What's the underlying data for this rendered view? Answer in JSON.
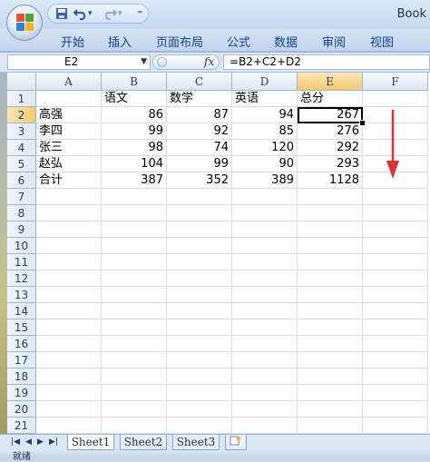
{
  "window": {
    "title": "Book"
  },
  "qat": {
    "undo_arrow": "▾",
    "redo_arrow": "▾",
    "customize": "⁼"
  },
  "ribbon": {
    "tabs": [
      "开始",
      "插入",
      "页面布局",
      "公式",
      "数据",
      "审阅",
      "视图"
    ]
  },
  "formula_bar": {
    "name_box": "E2",
    "fx": "fx",
    "formula": "=B2+C2+D2"
  },
  "sheet": {
    "columns": [
      "A",
      "B",
      "C",
      "D",
      "E",
      "F"
    ],
    "active_column": "E",
    "active_row": 2,
    "row_numbers": [
      "1",
      "2",
      "3",
      "4",
      "5",
      "6",
      "7",
      "8",
      "9",
      "10",
      "11",
      "12",
      "13",
      "14",
      "15",
      "16",
      "17",
      "18",
      "19",
      "20",
      "21"
    ],
    "rows": [
      [
        "",
        "语文",
        "数学",
        "英语",
        "总分"
      ],
      [
        "高强",
        "86",
        "87",
        "94",
        "267"
      ],
      [
        "李四",
        "99",
        "92",
        "85",
        "276"
      ],
      [
        "张三",
        "98",
        "74",
        "120",
        "292"
      ],
      [
        "赵弘",
        "104",
        "99",
        "90",
        "293"
      ],
      [
        "合计",
        "387",
        "352",
        "389",
        "1128"
      ]
    ],
    "annotation": {
      "arrow_color": "#e03030",
      "direction": "down"
    }
  },
  "sheet_tabs": [
    "Sheet1",
    "Sheet2",
    "Sheet3"
  ],
  "status": {
    "text": "就绪"
  },
  "colors": {
    "accent": "#15428b",
    "selection": "#f6c96f"
  }
}
